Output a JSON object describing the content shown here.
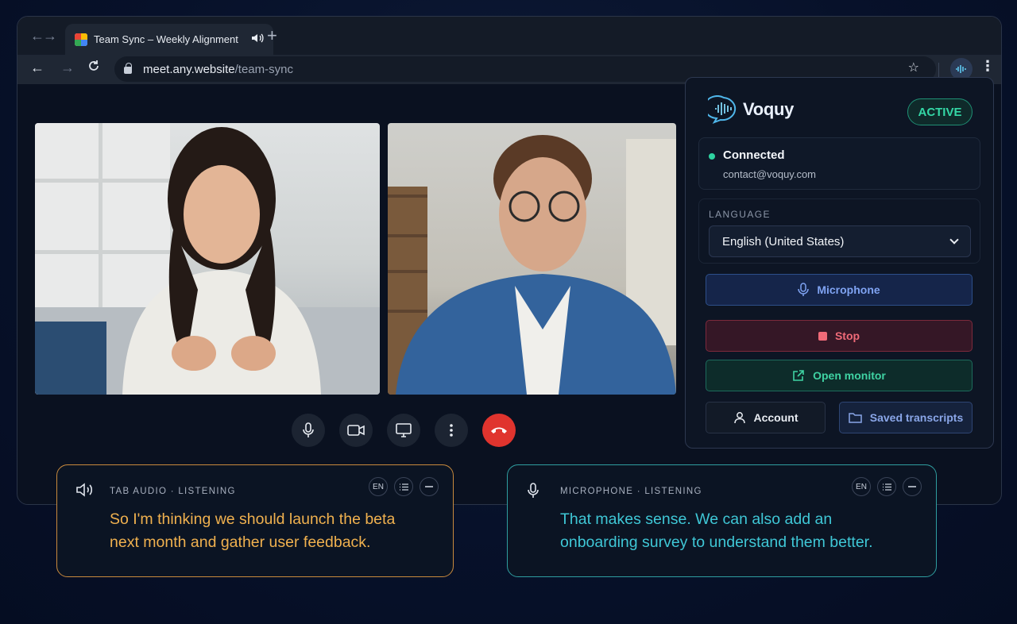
{
  "browser": {
    "tab_title": "Team Sync – Weekly Alignment",
    "url_host": "meet.any.website",
    "url_path": "/team-sync"
  },
  "meeting": {
    "participants": [
      "participant-1",
      "participant-2"
    ],
    "controls": [
      "microphone",
      "camera",
      "present",
      "more",
      "end-call"
    ]
  },
  "extension": {
    "brand": "Voquy",
    "status_badge": "ACTIVE",
    "connection_title": "Connected",
    "account_email": "contact@voquy.com",
    "language_label": "LANGUAGE",
    "language_value": "English (United States)",
    "microphone_label": "Microphone",
    "stop_label": "Stop",
    "open_monitor_label": "Open monitor",
    "account_label": "Account",
    "saved_label": "Saved transcripts"
  },
  "captions": [
    {
      "source": "TAB AUDIO · LISTENING",
      "lang": "EN",
      "text": "So I'm thinking we should launch the beta next month and gather user feedback.",
      "color": "#f0b14f"
    },
    {
      "source": "MICROPHONE · LISTENING",
      "lang": "EN",
      "text": "That makes sense. We can also add an onboarding survey to understand them better.",
      "color": "#3fc7d6"
    }
  ],
  "colors": {
    "accent_active": "#34d7a6",
    "stop": "#f06a78",
    "end_call": "#e0342e"
  }
}
